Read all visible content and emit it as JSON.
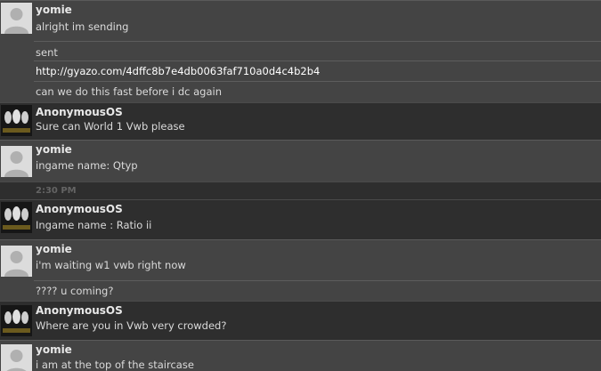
{
  "messages": [
    {
      "sender": "yomie",
      "lines": [
        "alright im sending",
        "sent",
        "http://gyazo.com/4dffc8b7e4db0063faf710a0d4c4b2b4",
        "can we do this fast before i dc again"
      ]
    },
    {
      "sender": "AnonymousOS",
      "lines": [
        "Sure can World 1 Vwb please"
      ]
    },
    {
      "sender": "yomie",
      "lines": [
        "ingame name: Qtyp"
      ]
    },
    {
      "timestamp": "2:30 PM"
    },
    {
      "sender": "AnonymousOS",
      "lines": [
        "Ingame name : Ratio ii"
      ]
    },
    {
      "sender": "yomie",
      "lines": [
        "i'm waiting w1 vwb right now",
        "???? u coming?"
      ]
    },
    {
      "sender": "AnonymousOS",
      "lines": [
        "Where are you in Vwb very crowded?"
      ]
    },
    {
      "sender": "yomie",
      "lines": [
        "i am at the top of the staircase"
      ]
    }
  ],
  "icons": {
    "generic_avatar": "user-silhouette-icon",
    "anon_avatar": "guy-fawkes-mask-icon"
  },
  "colors": {
    "light_row": "#444444",
    "dark_row": "#2e2e2e",
    "text": "#dadada",
    "timestamp": "#646464"
  }
}
